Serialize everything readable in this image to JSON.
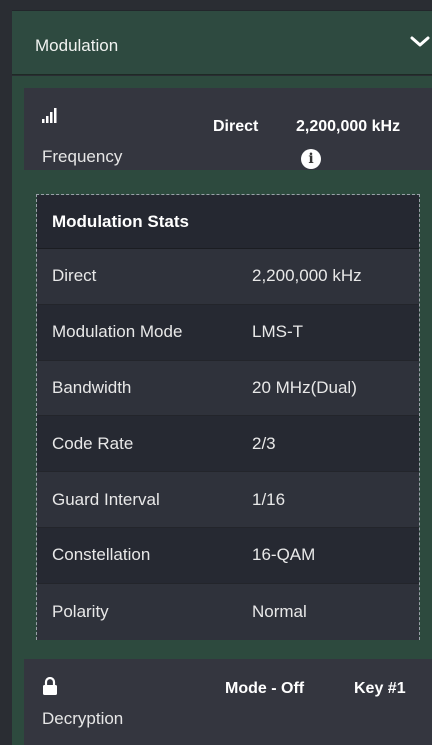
{
  "header": {
    "title": "Modulation",
    "icon": "chevron-down-icon"
  },
  "frequency": {
    "icon": "signal-bars-icon",
    "label": "Frequency",
    "mode": "Direct",
    "value": "2,200,000 kHz",
    "info_icon": "info-icon"
  },
  "stats": {
    "title": "Modulation Stats",
    "rows": [
      {
        "key": "Direct",
        "value": "2,200,000 kHz"
      },
      {
        "key": "Modulation Mode",
        "value": "LMS-T"
      },
      {
        "key": "Bandwidth",
        "value": "20 MHz(Dual)"
      },
      {
        "key": "Code Rate",
        "value": "2/3"
      },
      {
        "key": "Guard Interval",
        "value": "1/16"
      },
      {
        "key": "Constellation",
        "value": "16-QAM"
      },
      {
        "key": "Polarity",
        "value": "Normal"
      }
    ]
  },
  "decryption": {
    "icon": "lock-icon",
    "label": "Decryption",
    "mode": "Mode - Off",
    "key": "Key #1"
  },
  "colors": {
    "panel": "#2d4a3e",
    "card": "#34363f",
    "table_odd": "#2f323b",
    "table_even": "#262932"
  }
}
